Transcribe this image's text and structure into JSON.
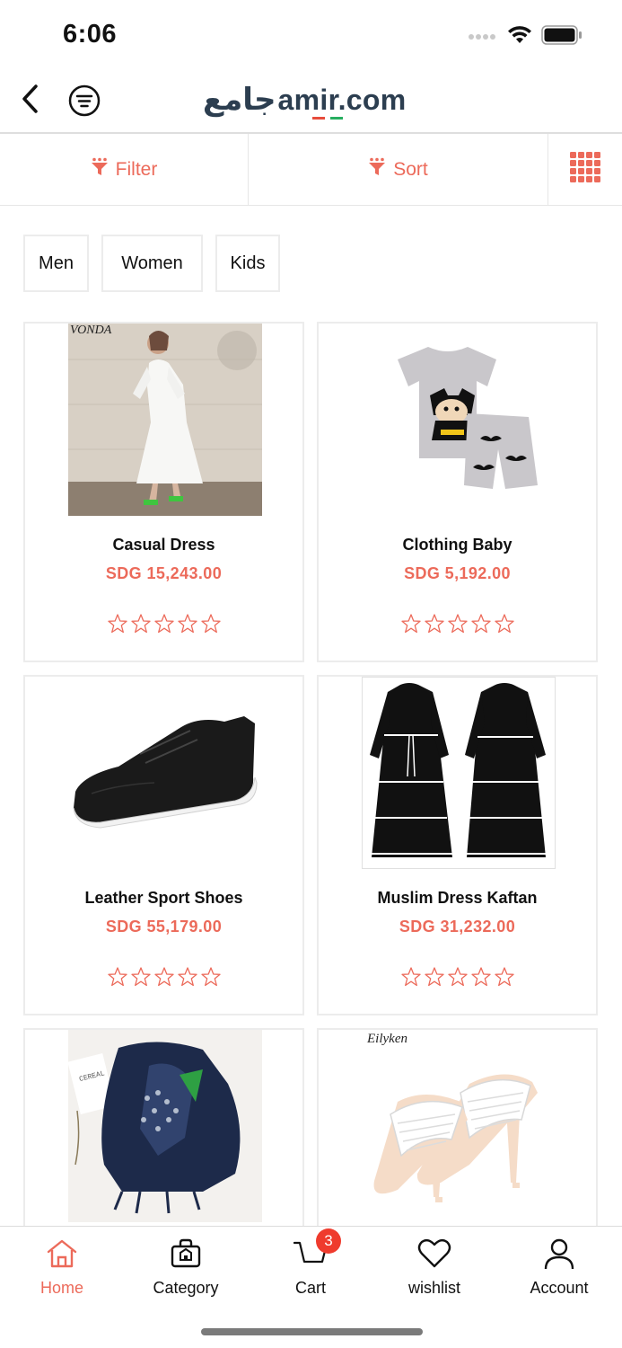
{
  "status_bar": {
    "time": "6:06"
  },
  "header": {
    "logo_arabic": "جامع",
    "logo_latin": "amir.com",
    "logo_full": "جامعamir.com"
  },
  "toolbar": {
    "filter_label": "Filter",
    "sort_label": "Sort",
    "icons": {
      "filter": "funnel-icon",
      "sort": "funnel-icon",
      "grid": "grid-view-icon"
    }
  },
  "categories": [
    {
      "label": "Men"
    },
    {
      "label": "Women"
    },
    {
      "label": "Kids"
    }
  ],
  "products": [
    {
      "name": "Casual Dress",
      "price": "SDG 15,243.00",
      "rating": 0,
      "brand_tag": "VONDA",
      "image": "white dress photo"
    },
    {
      "name": "Clothing Baby",
      "price": "SDG 5,192.00",
      "rating": 0,
      "brand_tag": "",
      "image": "baby batman outfit photo"
    },
    {
      "name": "Leather Sport Shoes",
      "price": "SDG 55,179.00",
      "rating": 0,
      "brand_tag": "",
      "image": "black sneaker photo"
    },
    {
      "name": "Muslim Dress Kaftan",
      "price": "SDG 31,232.00",
      "rating": 0,
      "brand_tag": "",
      "image": "black kaftan dresses photo"
    },
    {
      "name": "",
      "price": "",
      "rating": 0,
      "brand_tag": "",
      "image": "navy scarf photo"
    },
    {
      "name": "",
      "price": "",
      "rating": 0,
      "brand_tag": "Eilyken",
      "image": "white heeled sandals photo"
    }
  ],
  "bottom_nav": {
    "items": [
      {
        "label": "Home",
        "icon": "home-icon",
        "active": true
      },
      {
        "label": "Category",
        "icon": "category-bag-icon",
        "active": false
      },
      {
        "label": "Cart",
        "icon": "cart-icon",
        "active": false,
        "badge": "3"
      },
      {
        "label": "wishlist",
        "icon": "heart-icon",
        "active": false
      },
      {
        "label": "Account",
        "icon": "person-icon",
        "active": false
      }
    ]
  },
  "colors": {
    "accent": "#ec6a5a",
    "text": "#111111",
    "border": "#ececec",
    "badge": "#ef3b2d",
    "logo": "#2c3e50"
  }
}
